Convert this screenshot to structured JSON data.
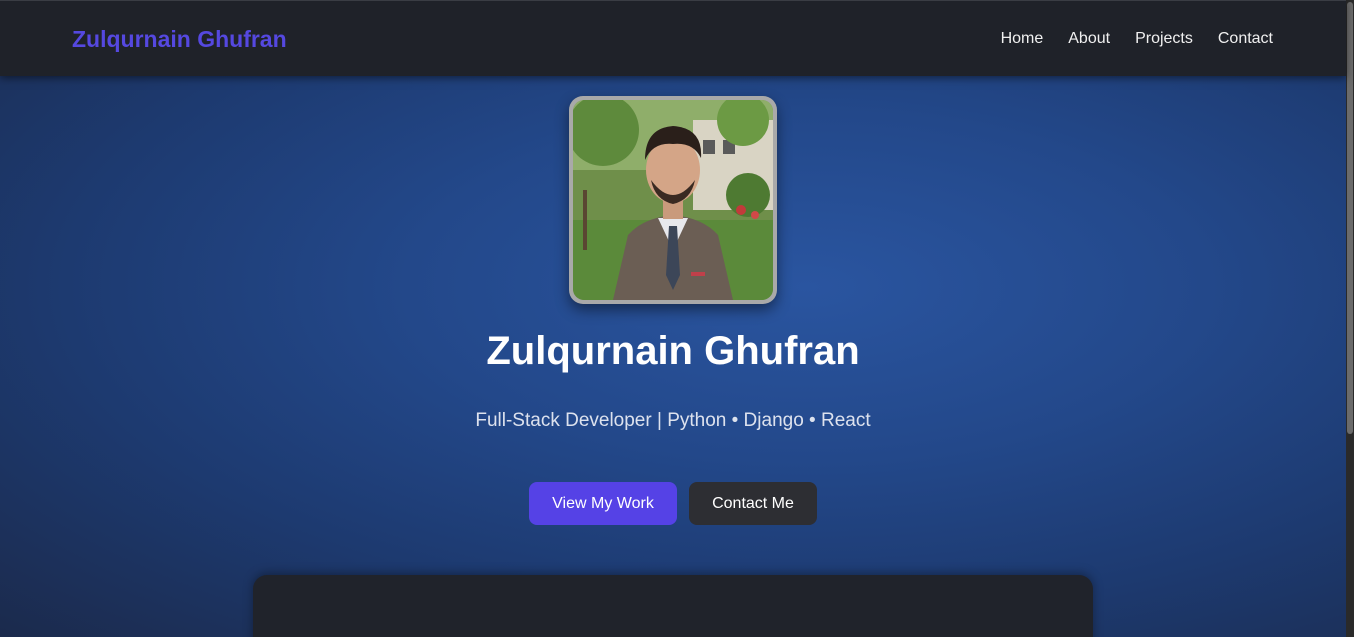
{
  "navbar": {
    "brand": "Zulqurnain Ghufran",
    "links": [
      "Home",
      "About",
      "Projects",
      "Contact"
    ]
  },
  "hero": {
    "avatar": "profile-photo",
    "name": "Zulqurnain Ghufran",
    "tagline": "Full-Stack Developer | Python • Django • React",
    "primary_button": "View My Work",
    "secondary_button": "Contact Me"
  },
  "colors": {
    "brand": "#5548e0",
    "primary_button": "#5542e6",
    "secondary_button": "#2d2e33",
    "navbar": "#1f2229",
    "hero_background": "#23488a"
  }
}
